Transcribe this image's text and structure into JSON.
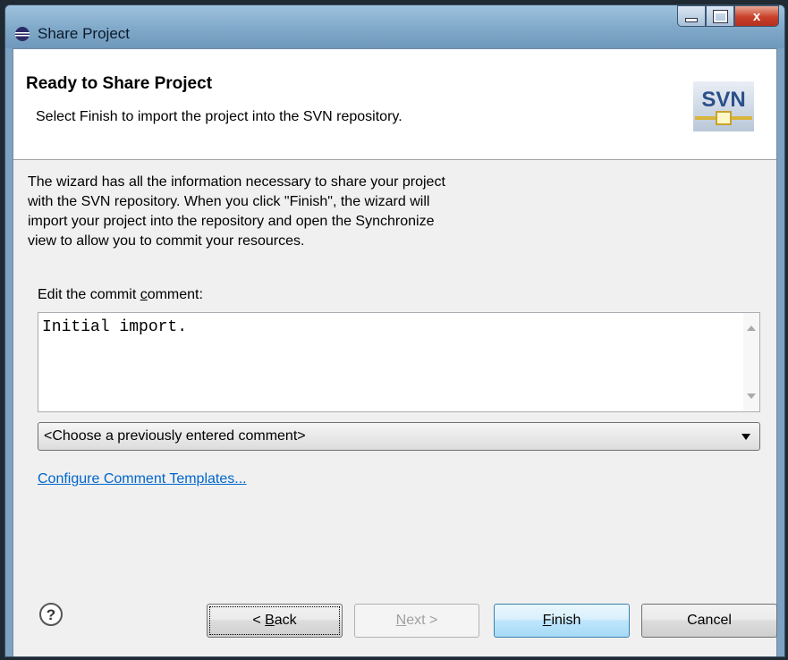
{
  "window": {
    "title": "Share Project",
    "close_glyph": "x"
  },
  "header": {
    "title": "Ready to Share Project",
    "message": "Select Finish to import the project into the SVN repository.",
    "logo_text": "SVN"
  },
  "description": {
    "lines": [
      "The wizard has all the information necessary to share your project",
      "with the SVN repository. When you click \"Finish\", the wizard will",
      "import your project into the repository and open the Synchronize",
      "view to allow you to commit your resources."
    ]
  },
  "commit": {
    "label_prefix": "Edit the commit ",
    "label_mnemonic": "c",
    "label_suffix": "omment:",
    "value": "Initial import.",
    "history_selected": "<Choose a previously entered comment>"
  },
  "link": {
    "label": "Configure Comment Templates..."
  },
  "buttons": {
    "help": "?",
    "back_prefix": "< ",
    "back_mnemonic": "B",
    "back_suffix": "ack",
    "next_mnemonic": "N",
    "next_suffix": "ext >",
    "finish_mnemonic": "F",
    "finish_suffix": "inish",
    "cancel": "Cancel"
  },
  "colors": {
    "titlebar": "#7fa8c9",
    "link": "#0066cc",
    "dialog_bg": "#f0f0f0"
  },
  "icons": {
    "app": "eclipse-icon",
    "help": "help-icon",
    "logo": "svn-logo-icon"
  }
}
